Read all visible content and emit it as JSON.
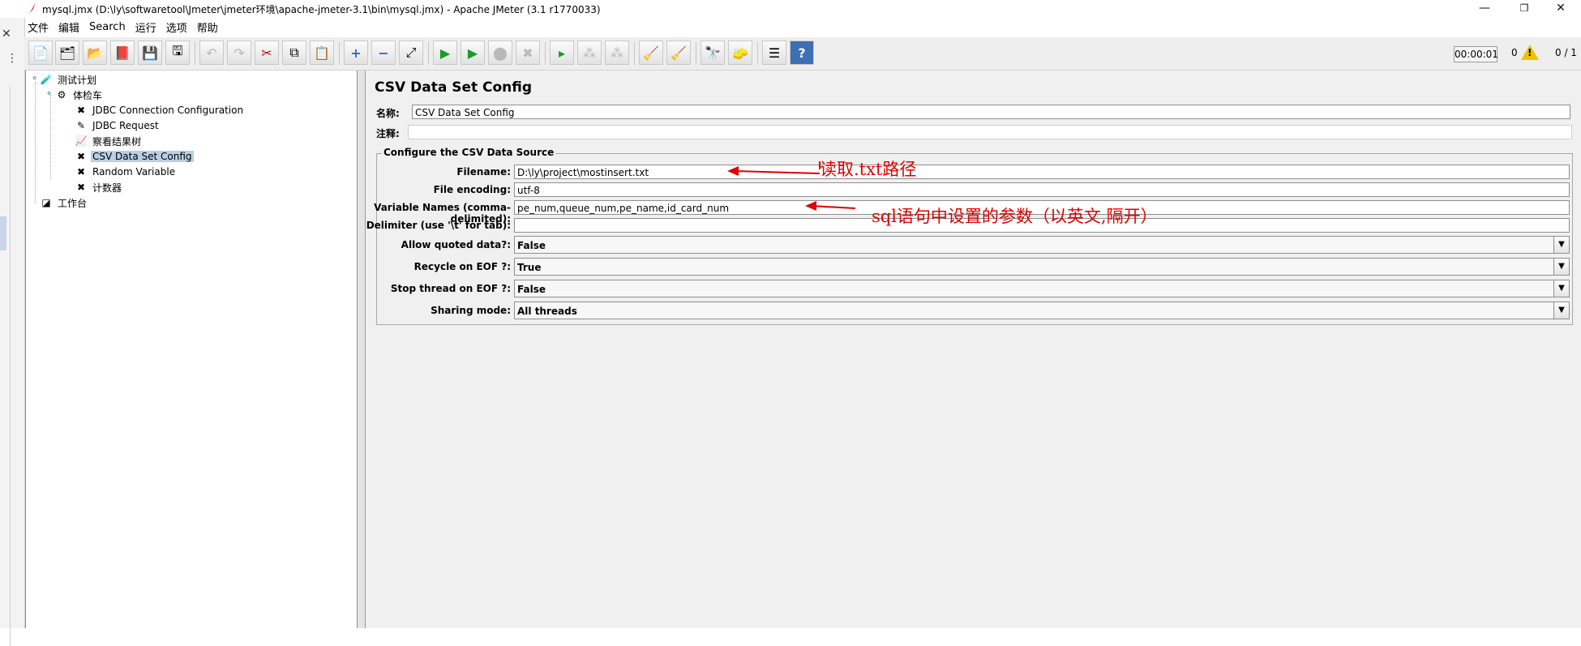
{
  "window": {
    "title": "mysql.jmx (D:\\ly\\softwaretool\\Jmeter\\jmeter环境\\apache-jmeter-3.1\\bin\\mysql.jmx) - Apache JMeter (3.1 r1770033)",
    "controls": {
      "minimize": "—",
      "restore": "❐",
      "close": "✕"
    }
  },
  "menu": [
    "文件",
    "编辑",
    "Search",
    "运行",
    "选项",
    "帮助"
  ],
  "status": {
    "timer": "00:00:01",
    "errors": "0",
    "threads": "0 / 1"
  },
  "tree": {
    "items": [
      {
        "label": "测试计划",
        "icon": "test-plan-icon"
      },
      {
        "label": "体检车",
        "icon": "thread-group-icon"
      },
      {
        "label": "JDBC Connection Configuration",
        "icon": "config-element-icon"
      },
      {
        "label": "JDBC Request",
        "icon": "sampler-icon"
      },
      {
        "label": "察看结果树",
        "icon": "listener-icon"
      },
      {
        "label": "CSV Data Set Config",
        "icon": "config-element-icon"
      },
      {
        "label": "Random Variable",
        "icon": "config-element-icon"
      },
      {
        "label": "计数器",
        "icon": "config-element-icon"
      },
      {
        "label": "工作台",
        "icon": "workbench-icon"
      }
    ]
  },
  "panel": {
    "title": "CSV Data Set Config",
    "name_label": "名称:",
    "name_value": "CSV Data Set Config",
    "comment_label": "注释:",
    "comment_value": "",
    "group_title": "Configure the CSV Data Source",
    "fields": {
      "filename": {
        "label": "Filename:",
        "value": "D:\\ly\\project\\mostinsert.txt"
      },
      "encoding": {
        "label": "File encoding:",
        "value": "utf-8"
      },
      "varnames": {
        "label": "Variable Names (comma-delimited):",
        "value": "pe_num,queue_num,pe_name,id_card_num"
      },
      "delimiter": {
        "label": "Delimiter (use '\\t' for tab):",
        "value": ""
      },
      "quoted": {
        "label": "Allow quoted data?:",
        "value": "False"
      },
      "recycle": {
        "label": "Recycle on EOF ?:",
        "value": "True"
      },
      "stop": {
        "label": "Stop thread on EOF ?:",
        "value": "False"
      },
      "sharing": {
        "label": "Sharing mode:",
        "value": "All threads"
      }
    }
  },
  "annotations": {
    "filename_note": "读取.txt路径",
    "varnames_note": "sql语句中设置的参数（以英文,隔开）"
  },
  "colors": {
    "annotation": "#e00000",
    "selection": "#b8cfe5"
  }
}
